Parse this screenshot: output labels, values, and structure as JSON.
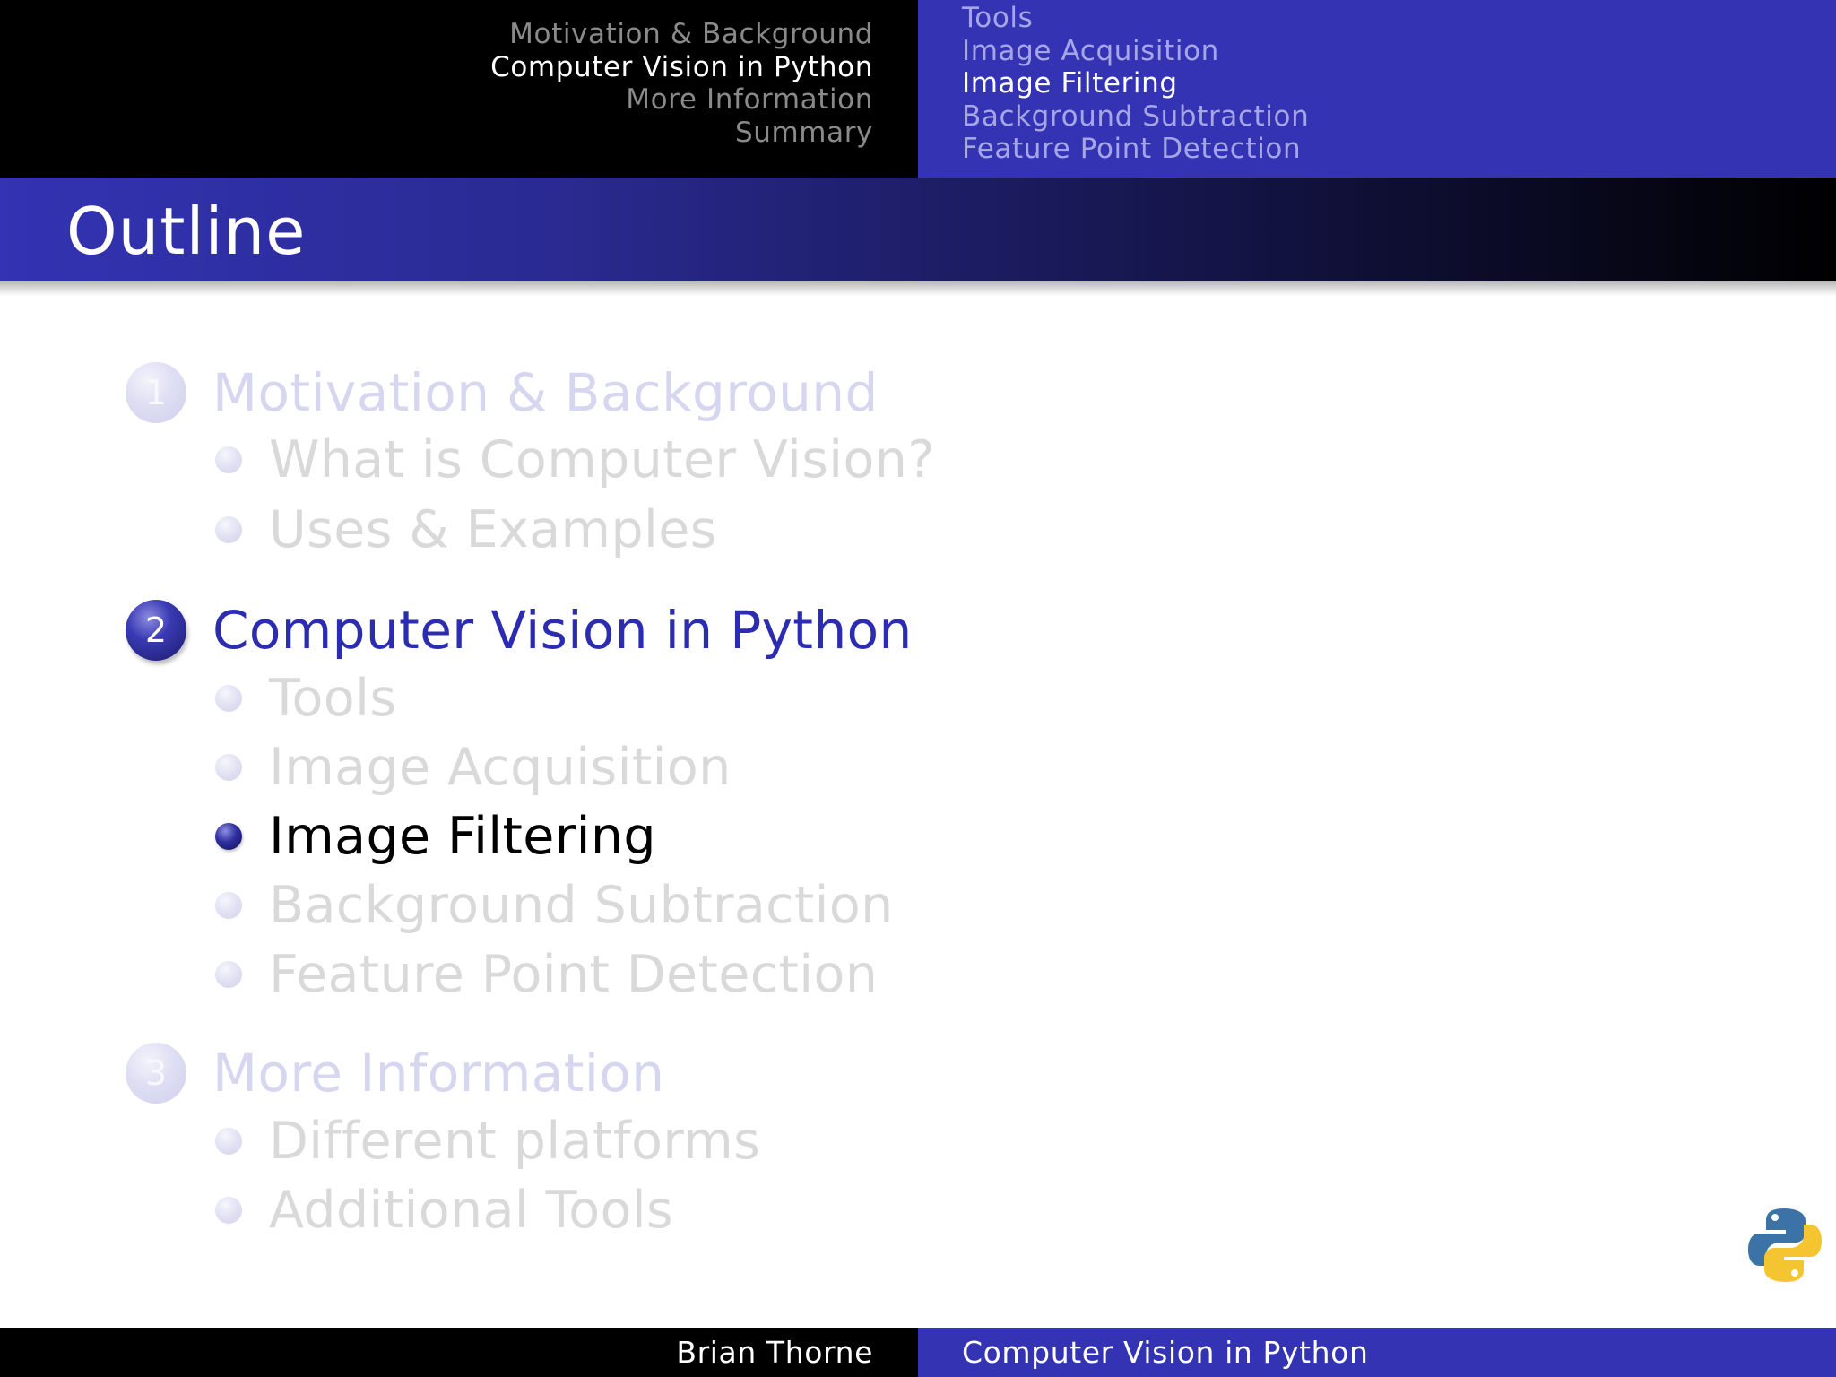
{
  "header": {
    "sections": [
      {
        "label": "Motivation & Background",
        "active": false
      },
      {
        "label": "Computer Vision in Python",
        "active": true
      },
      {
        "label": "More Information",
        "active": false
      },
      {
        "label": "Summary",
        "active": false
      }
    ],
    "subsections": [
      {
        "label": "Tools",
        "active": false
      },
      {
        "label": "Image Acquisition",
        "active": false
      },
      {
        "label": "Image Filtering",
        "active": true
      },
      {
        "label": "Background Subtraction",
        "active": false
      },
      {
        "label": "Feature Point Detection",
        "active": false
      }
    ]
  },
  "frame": {
    "title": "Outline"
  },
  "toc": [
    {
      "number": "1",
      "label": "Motivation & Background",
      "active": false,
      "items": [
        {
          "label": "What is Computer Vision?",
          "active": false
        },
        {
          "label": "Uses & Examples",
          "active": false
        }
      ]
    },
    {
      "number": "2",
      "label": "Computer Vision in Python",
      "active": true,
      "items": [
        {
          "label": "Tools",
          "active": false
        },
        {
          "label": "Image Acquisition",
          "active": false
        },
        {
          "label": "Image Filtering",
          "active": true
        },
        {
          "label": "Background Subtraction",
          "active": false
        },
        {
          "label": "Feature Point Detection",
          "active": false
        }
      ]
    },
    {
      "number": "3",
      "label": "More Information",
      "active": false,
      "items": [
        {
          "label": "Different platforms",
          "active": false
        },
        {
          "label": "Additional Tools",
          "active": false
        }
      ]
    }
  ],
  "footer": {
    "author": "Brian Thorne",
    "title": "Computer Vision in Python"
  },
  "logo": {
    "icon": "python-logo-icon",
    "colors": {
      "blue": "#3b73a6",
      "yellow": "#f5c531"
    }
  },
  "colors": {
    "structure": "#3333b3",
    "header_left": "#000000",
    "active_section": "#2c2cb0",
    "faded_section": "#d6d6f1",
    "faded_item": "#d9d9d9"
  }
}
